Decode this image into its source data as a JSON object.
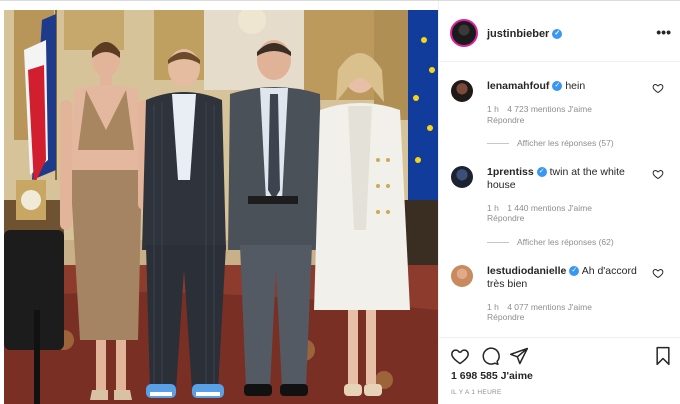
{
  "post": {
    "author": "justinbieber",
    "author_verified": true,
    "more_label": "•••"
  },
  "comments": [
    {
      "username": "lenamahfouf",
      "verified": true,
      "text": "hein",
      "age": "1 h",
      "likes": "4 723 mentions J'aime",
      "reply": "Répondre",
      "replies": "Afficher les réponses (57)"
    },
    {
      "username": "1prentiss",
      "verified": true,
      "text": "twin at the white house",
      "age": "1 h",
      "likes": "1 440 mentions J'aime",
      "reply": "Répondre",
      "replies": "Afficher les réponses (62)"
    },
    {
      "username": "lestudiodanielle",
      "verified": true,
      "text": "Ah d'accord très bien",
      "age": "1 h",
      "likes": "4 077 mentions J'aime",
      "reply": "Répondre",
      "replies": ""
    }
  ],
  "actions": {
    "like_icon": "heart-outline-icon",
    "comment_icon": "comment-bubble-icon",
    "share_icon": "paper-plane-icon",
    "save_icon": "bookmark-icon"
  },
  "footer": {
    "likes": "1 698 585 J'aime",
    "timestamp": "IL Y A 1 HEURE"
  },
  "colors": {
    "verified": "#3897f0",
    "story_ring": "#d6249f",
    "muted_text": "#8e8e8e"
  }
}
